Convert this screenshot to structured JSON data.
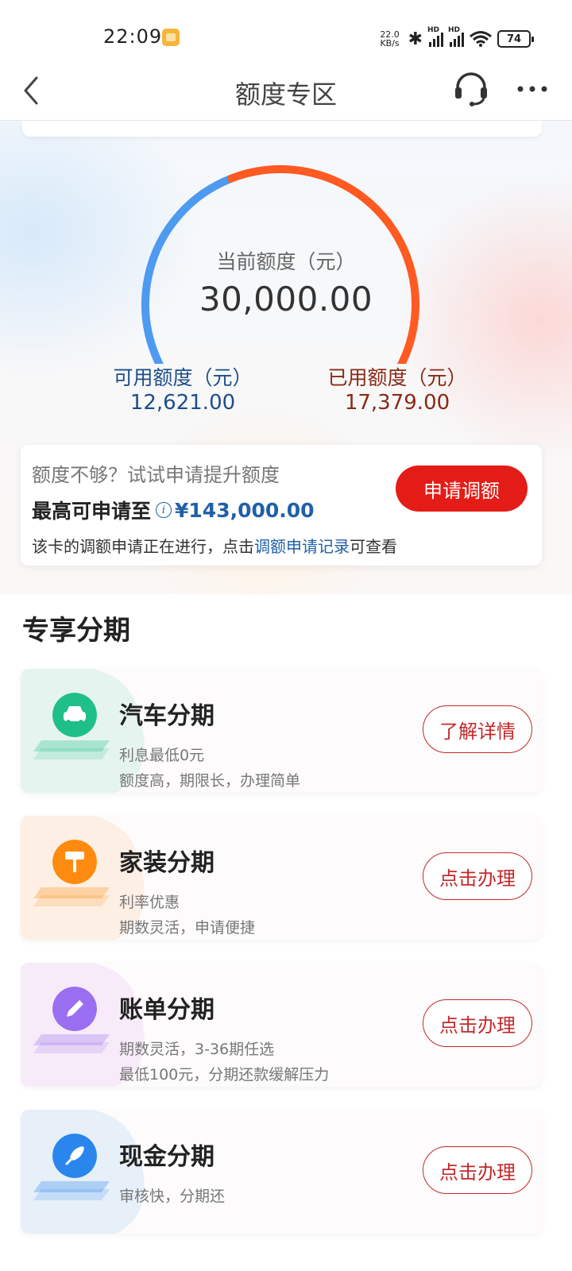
{
  "status_bar": {
    "time": "22:09",
    "net_speed_value": "22.0",
    "net_speed_unit": "KB/s",
    "signal_label": "HD",
    "battery": "74",
    "icons": [
      "notification-icon",
      "bluetooth-icon",
      "signal-icon",
      "wifi-icon",
      "battery-icon"
    ]
  },
  "nav": {
    "title": "额度专区",
    "icons": [
      "back-icon",
      "headset-icon",
      "more-icon"
    ]
  },
  "quota": {
    "current_label": "当前额度（元）",
    "current_value": "30,000.00",
    "available_label": "可用额度（元）",
    "available_value": "12,621.00",
    "used_label": "已用额度（元）",
    "used_value": "17,379.00",
    "gauge_used_fraction": 0.5793,
    "colors": {
      "available": "#4d9af0",
      "used": "#ff5a22"
    }
  },
  "raise": {
    "prompt": "额度不够？试试申请提升额度",
    "max_label": "最高可申请至",
    "max_value": "¥143,000.00",
    "note_prefix": "该卡的调额申请正在进行，点击",
    "note_link": "调额申请记录",
    "note_suffix": "可查看",
    "button": "申请调额",
    "accent": "#e41c17"
  },
  "section": {
    "title": "专享分期",
    "items": [
      {
        "title": "汽车分期",
        "line1": "利息最低0元",
        "line2": "额度高，期限长，办理简单",
        "button": "了解详情",
        "icon": "car-icon",
        "color": "#1fbf8a"
      },
      {
        "title": "家装分期",
        "line1": "利率优惠",
        "line2": "期数灵活，申请便捷",
        "button": "点击办理",
        "icon": "paint-roller-icon",
        "color": "#ff8a10"
      },
      {
        "title": "账单分期",
        "line1": "期数灵活，3-36期任选",
        "line2": "最低100元，分期还款缓解压力",
        "button": "点击办理",
        "icon": "pencil-icon",
        "color": "#9a6ef0"
      },
      {
        "title": "现金分期",
        "line1": "审核快，分期还",
        "line2": "",
        "button": "点击办理",
        "icon": "rocket-icon",
        "color": "#2a86ec"
      }
    ]
  }
}
